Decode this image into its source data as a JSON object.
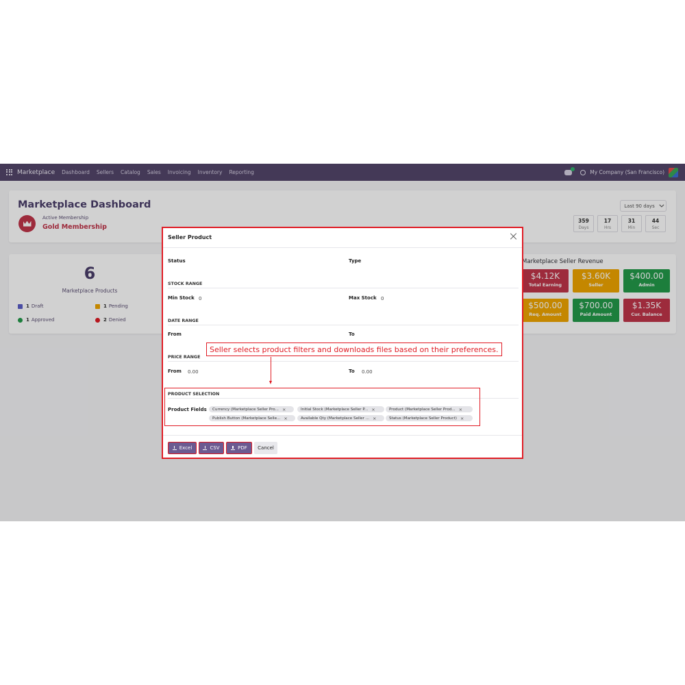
{
  "navbar": {
    "brand": "Marketplace",
    "menu": [
      "Dashboard",
      "Sellers",
      "Catalog",
      "Sales",
      "Invoicing",
      "Inventory",
      "Reporting"
    ],
    "company": "My Company (San Francisco)"
  },
  "header": {
    "title": "Marketplace Dashboard",
    "membership_label": "Active Membership",
    "membership_value": "Gold Membership",
    "range": "Last 90 days",
    "timer": [
      {
        "value": "359",
        "unit": "Days"
      },
      {
        "value": "17",
        "unit": "Hrs"
      },
      {
        "value": "31",
        "unit": "Min"
      },
      {
        "value": "44",
        "unit": "Sec"
      }
    ]
  },
  "stats": {
    "count": "6",
    "label": "Marketplace Products",
    "draft": {
      "num": "1",
      "label": "Draft"
    },
    "pending": {
      "num": "1",
      "label": "Pending"
    },
    "approved": {
      "num": "1",
      "label": "Approved"
    },
    "denied": {
      "num": "2",
      "label": "Denied"
    }
  },
  "revenue": {
    "title": "Marketplace Seller Revenue",
    "tiles": [
      {
        "value": "$4.12K",
        "label": "Total Earning",
        "color": "#c0354a"
      },
      {
        "value": "$3.60K",
        "label": "Seller",
        "color": "#f0a500"
      },
      {
        "value": "$400.00",
        "label": "Admin",
        "color": "#239a4a"
      },
      {
        "value": "$500.00",
        "label": "Req. Amount",
        "color": "#f0a500"
      },
      {
        "value": "$700.00",
        "label": "Paid Amount",
        "color": "#239a4a"
      },
      {
        "value": "$1.35K",
        "label": "Cur. Balance",
        "color": "#c0354a"
      }
    ]
  },
  "modal": {
    "title": "Seller Product",
    "status_label": "Status",
    "type_label": "Type",
    "stock_section": "STOCK RANGE",
    "min_stock_label": "Min Stock",
    "min_stock_value": "0",
    "max_stock_label": "Max Stock",
    "max_stock_value": "0",
    "date_section": "DATE RANGE",
    "date_from_label": "From",
    "date_to_label": "To",
    "price_section": "PRICE RANGE",
    "price_from_label": "From",
    "price_from_value": "0.00",
    "price_to_label": "To",
    "price_to_value": "0.00",
    "product_section": "PRODUCT SELECTION",
    "fields_label": "Product Fields",
    "tags": [
      "Currency (Marketplace Seller Pro...",
      "Initial Stock (Marketplace Seller P...",
      "Product (Marketplace Seller Prod...",
      "Publish Button (Marketplace Selle...",
      "Available Qty (Marketplace Seller ...",
      "Status (Marketplace Seller Product)"
    ],
    "buttons": {
      "excel": "Excel",
      "csv": "CSV",
      "pdf": "PDF",
      "cancel": "Cancel"
    }
  },
  "callout": "Seller selects product filters and downloads files based on their preferences."
}
